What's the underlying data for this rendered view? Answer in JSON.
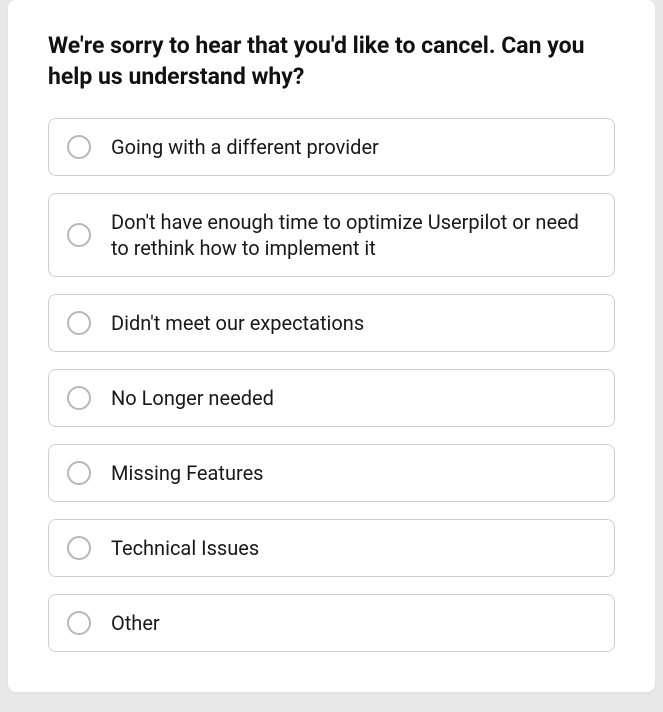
{
  "question": "We're sorry to hear that you'd like to cancel. Can you help us understand why?",
  "options": [
    {
      "label": "Going with a different provider"
    },
    {
      "label": "Don't have enough time to optimize Userpilot or need to rethink how to implement it"
    },
    {
      "label": "Didn't meet our expectations"
    },
    {
      "label": "No Longer needed"
    },
    {
      "label": "Missing Features"
    },
    {
      "label": "Technical Issues"
    },
    {
      "label": "Other"
    }
  ]
}
